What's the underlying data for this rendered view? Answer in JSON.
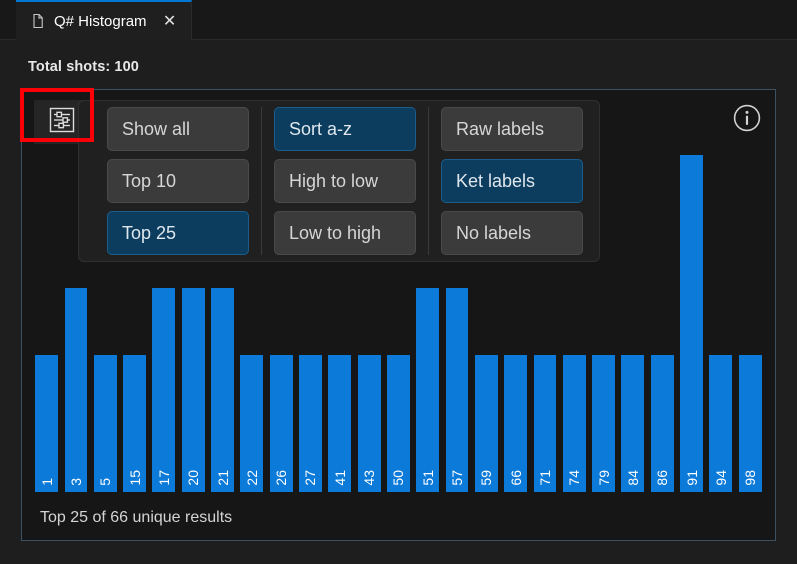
{
  "window": {
    "background": "#1e1e1e",
    "accent": "#0078d4"
  },
  "tab": {
    "title": "Q# Histogram",
    "doc_icon": "document-icon",
    "close_icon": "close-icon",
    "close_glyph": "✕"
  },
  "header": {
    "total_shots_label": "Total shots: 100"
  },
  "toolbar": {
    "filter_icon": "sliders-filter-icon",
    "info_icon": "info-circle-icon",
    "groups": [
      {
        "name": "count-group",
        "buttons": [
          {
            "label": "Show all",
            "active": false
          },
          {
            "label": "Top 10",
            "active": false
          },
          {
            "label": "Top 25",
            "active": true
          }
        ]
      },
      {
        "name": "sort-group",
        "buttons": [
          {
            "label": "Sort a-z",
            "active": true
          },
          {
            "label": "High to low",
            "active": false
          },
          {
            "label": "Low to high",
            "active": false
          }
        ]
      },
      {
        "name": "label-group",
        "buttons": [
          {
            "label": "Raw labels",
            "active": false
          },
          {
            "label": "Ket labels",
            "active": true
          },
          {
            "label": "No labels",
            "active": false
          }
        ]
      }
    ]
  },
  "footer": {
    "summary": "Top 25 of 66 unique results"
  },
  "annotation": {
    "color": "#fb0007",
    "target": "filter-settings-button"
  },
  "chart_data": {
    "type": "bar",
    "title": "Q# Histogram",
    "xlabel": "",
    "ylabel": "",
    "grid": false,
    "legend": "none",
    "bar_color": "#0b7ad8",
    "total_shots": 100,
    "unique_results": 66,
    "shown": 25,
    "ylim": [
      0,
      5
    ],
    "categories": [
      "1",
      "3",
      "5",
      "15",
      "17",
      "20",
      "21",
      "22",
      "26",
      "27",
      "41",
      "43",
      "50",
      "51",
      "57",
      "59",
      "66",
      "71",
      "74",
      "79",
      "84",
      "86",
      "91",
      "94",
      "98"
    ],
    "values": [
      2,
      3,
      2,
      2,
      3,
      3,
      3,
      2,
      2,
      2,
      2,
      2,
      2,
      3,
      3,
      2,
      2,
      2,
      2,
      2,
      2,
      2,
      5,
      2,
      2
    ]
  }
}
